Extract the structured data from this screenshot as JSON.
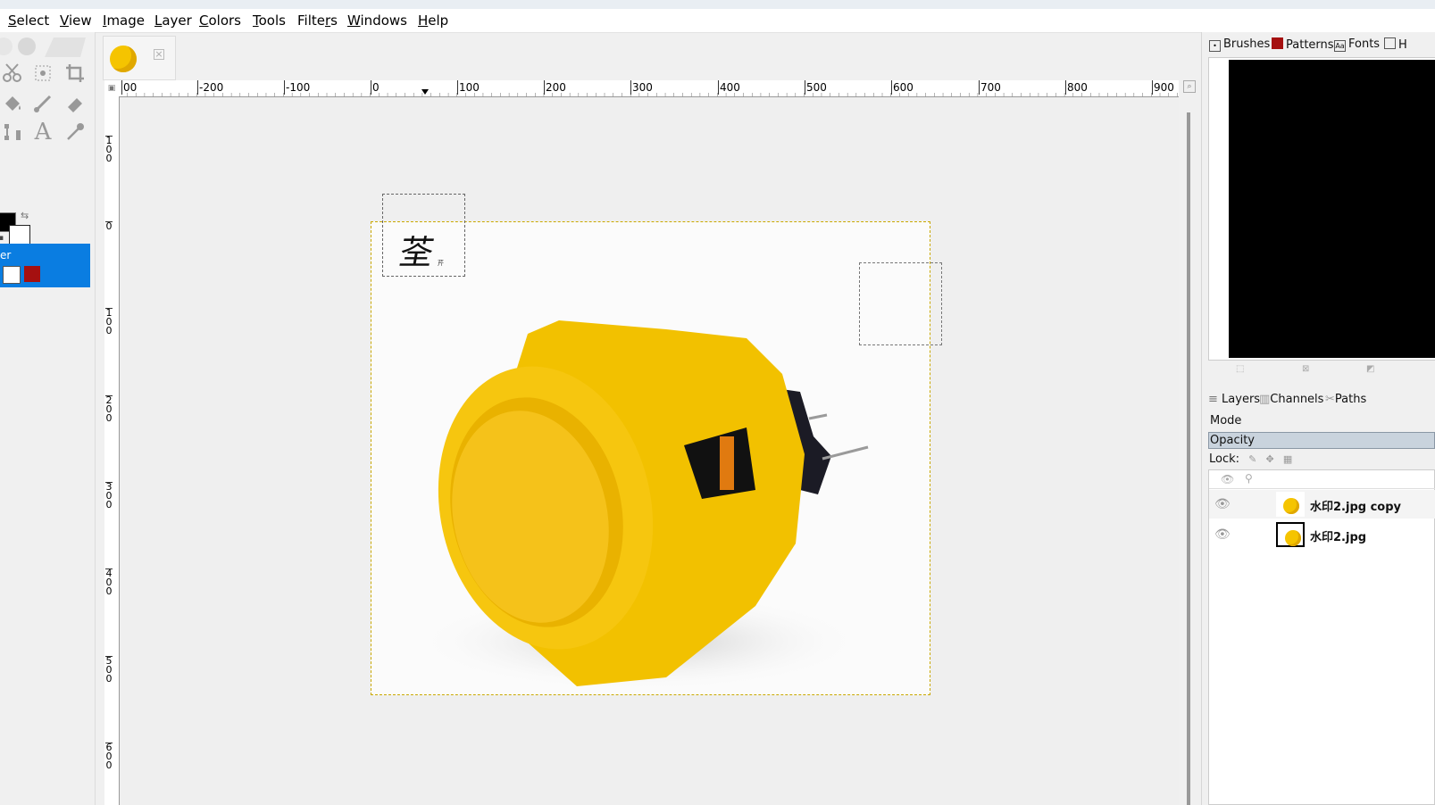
{
  "menubar": {
    "items": [
      {
        "label": "Select",
        "mnemonic": "S"
      },
      {
        "label": "View",
        "mnemonic": "V"
      },
      {
        "label": "Image",
        "mnemonic": "I"
      },
      {
        "label": "Layer",
        "mnemonic": "L"
      },
      {
        "label": "Colors",
        "mnemonic": "C"
      },
      {
        "label": "Tools",
        "mnemonic": "T"
      },
      {
        "label": "Filters",
        "mnemonic": "r"
      },
      {
        "label": "Windows",
        "mnemonic": "W"
      },
      {
        "label": "Help",
        "mnemonic": "H"
      }
    ]
  },
  "toolbox": {
    "tools": [
      "scissors-select-icon",
      "fuzzy-select-icon",
      "crop-icon",
      "bucket-fill-icon",
      "paintbrush-icon",
      "eraser-icon",
      "warp-transform-icon",
      "text-icon",
      "color-picker-icon"
    ],
    "text_tool_glyph": "A",
    "fg_color": "#000000",
    "bg_color": "#ffffff",
    "selected_row_label": "er"
  },
  "rulers": {
    "horizontal_labels": [
      "00",
      "-200",
      "-100",
      "0",
      "100",
      "200",
      "300",
      "400",
      "500",
      "600",
      "700",
      "800",
      "900"
    ],
    "vertical_labels": [
      "1\n0\n0",
      "0",
      "1\n0\n0",
      "2\n0\n0",
      "3\n0\n0",
      "4\n0\n0",
      "5\n0\n0",
      "6\n0\n0"
    ]
  },
  "canvas": {
    "watermark_glyph": "荃",
    "watermark_small": "芹"
  },
  "dock": {
    "top_tabs": [
      {
        "label": "Brushes",
        "icon": "brush-icon"
      },
      {
        "label": "Patterns",
        "icon": "pattern-icon"
      },
      {
        "label": "Fonts",
        "icon": "font-icon"
      },
      {
        "label": "H",
        "icon": "document-history-icon"
      }
    ],
    "layer_tabs": [
      {
        "label": "Layers"
      },
      {
        "label": "Channels"
      },
      {
        "label": "Paths"
      }
    ],
    "mode_label": "Mode",
    "opacity_label": "Opacity",
    "lock_label": "Lock:",
    "layers": [
      {
        "name": "水印2.jpg copy",
        "selected": false
      },
      {
        "name": "水印2.jpg",
        "selected": true
      }
    ]
  }
}
